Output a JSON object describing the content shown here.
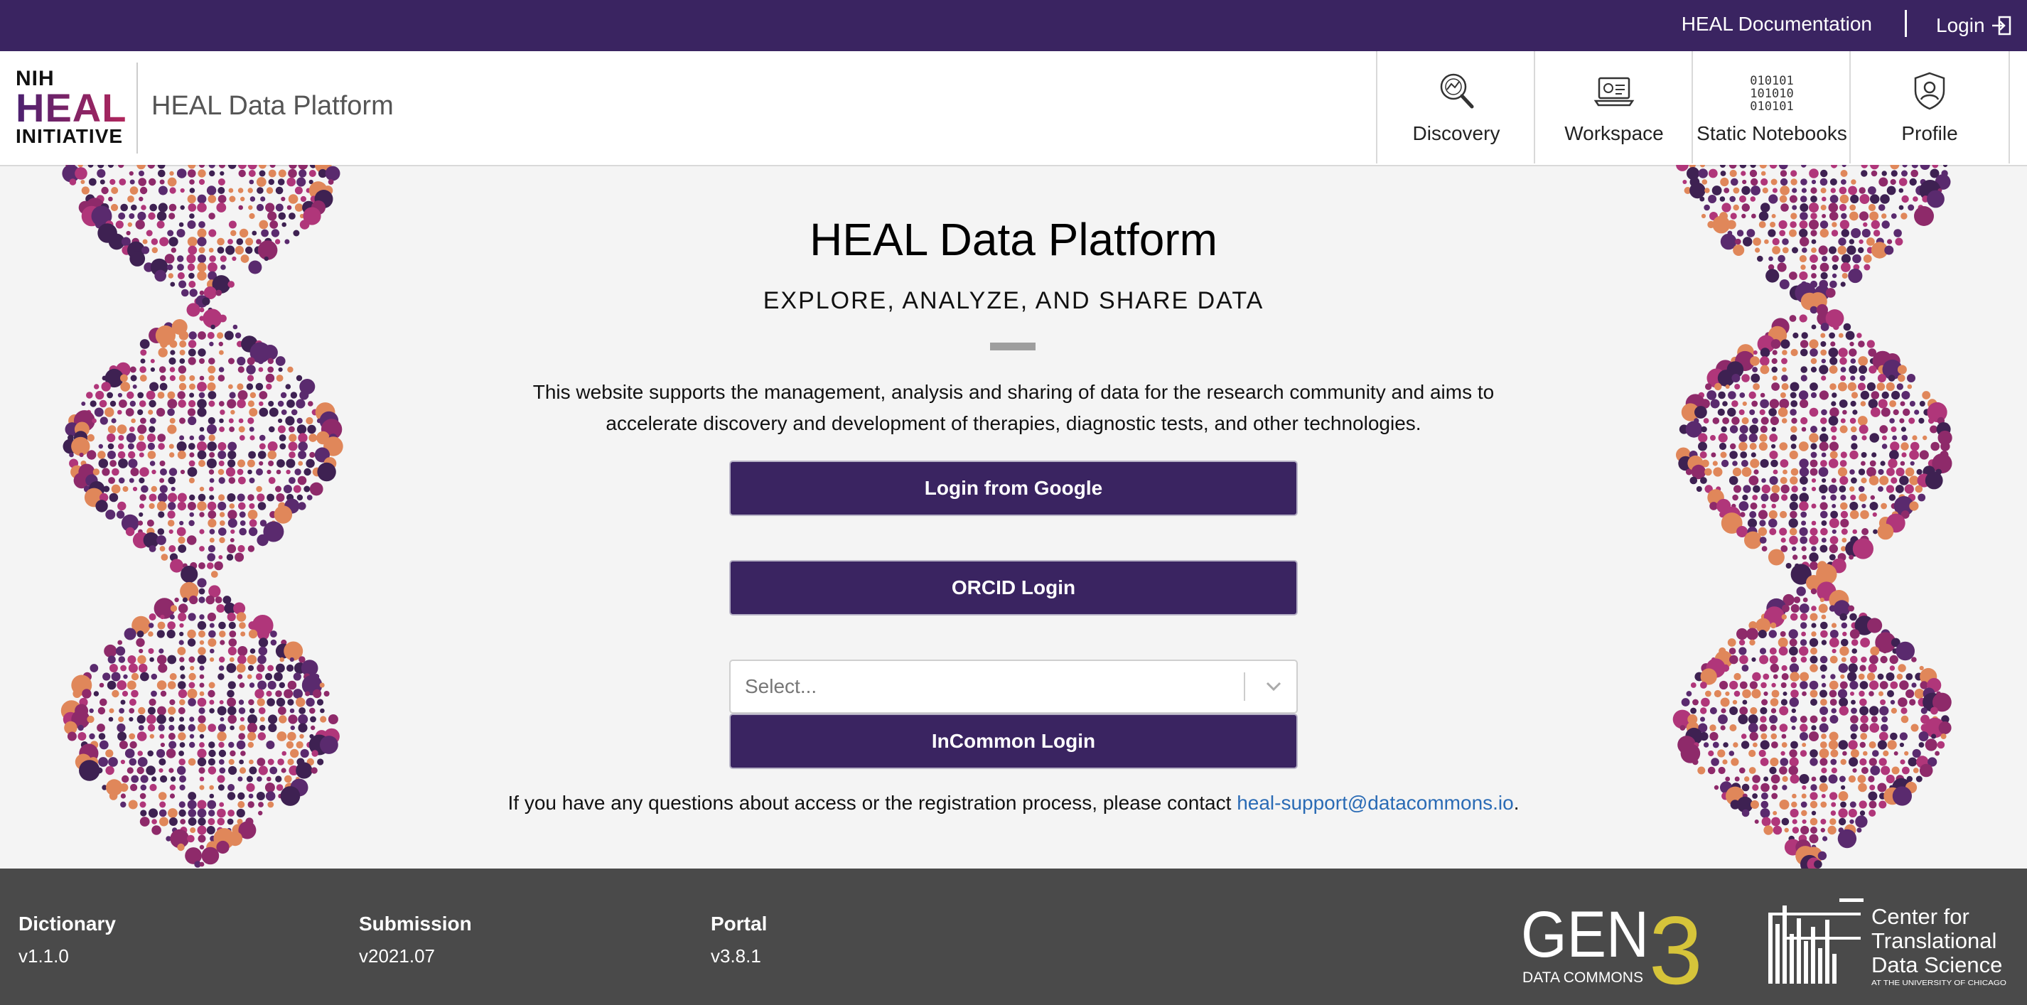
{
  "topbar": {
    "documentation_label": "HEAL Documentation",
    "login_label": "Login"
  },
  "header": {
    "logo": {
      "line1": "NIH",
      "line2": "HEAL",
      "line3": "INITIATIVE"
    },
    "site_title": "HEAL Data Platform",
    "nav": [
      {
        "label": "Discovery",
        "icon": "discovery-icon"
      },
      {
        "label": "Workspace",
        "icon": "workspace-icon"
      },
      {
        "label": "Static Notebooks",
        "icon": "binary-icon"
      },
      {
        "label": "Profile",
        "icon": "profile-icon"
      }
    ],
    "binary_icon_text": [
      "010101",
      "101010",
      "010101"
    ]
  },
  "main": {
    "title": "HEAL Data Platform",
    "subtitle": "EXPLORE, ANALYZE, AND SHARE DATA",
    "description": "This website supports the management, analysis and sharing of data for the research community and aims to accelerate discovery and development of therapies, diagnostic tests, and other technologies.",
    "google_login_label": "Login from Google",
    "orcid_login_label": "ORCID Login",
    "select_placeholder": "Select...",
    "incommon_login_label": "InCommon Login",
    "contact_text": "If you have any questions about access or the registration process, please contact ",
    "contact_email": "heal-support@datacommons.io",
    "contact_end": "."
  },
  "footer": {
    "columns": [
      {
        "title": "Dictionary",
        "value": "v1.1.0"
      },
      {
        "title": "Submission",
        "value": "v2021.07"
      },
      {
        "title": "Portal",
        "value": "v3.8.1"
      }
    ],
    "gen3_logo": {
      "word": "GEN",
      "digit": "3",
      "caption": "DATA COMMONS"
    },
    "ctds_logo": {
      "line1": "Center for",
      "line2": "Translational",
      "line3": "Data Science",
      "line4": "AT THE UNIVERSITY OF CHICAGO"
    }
  },
  "colors": {
    "primary_purple": "#3a2461",
    "link_blue": "#2a6bb5",
    "footer_gray": "#4a4a4a",
    "gen3_yellow": "#d6c43a"
  }
}
